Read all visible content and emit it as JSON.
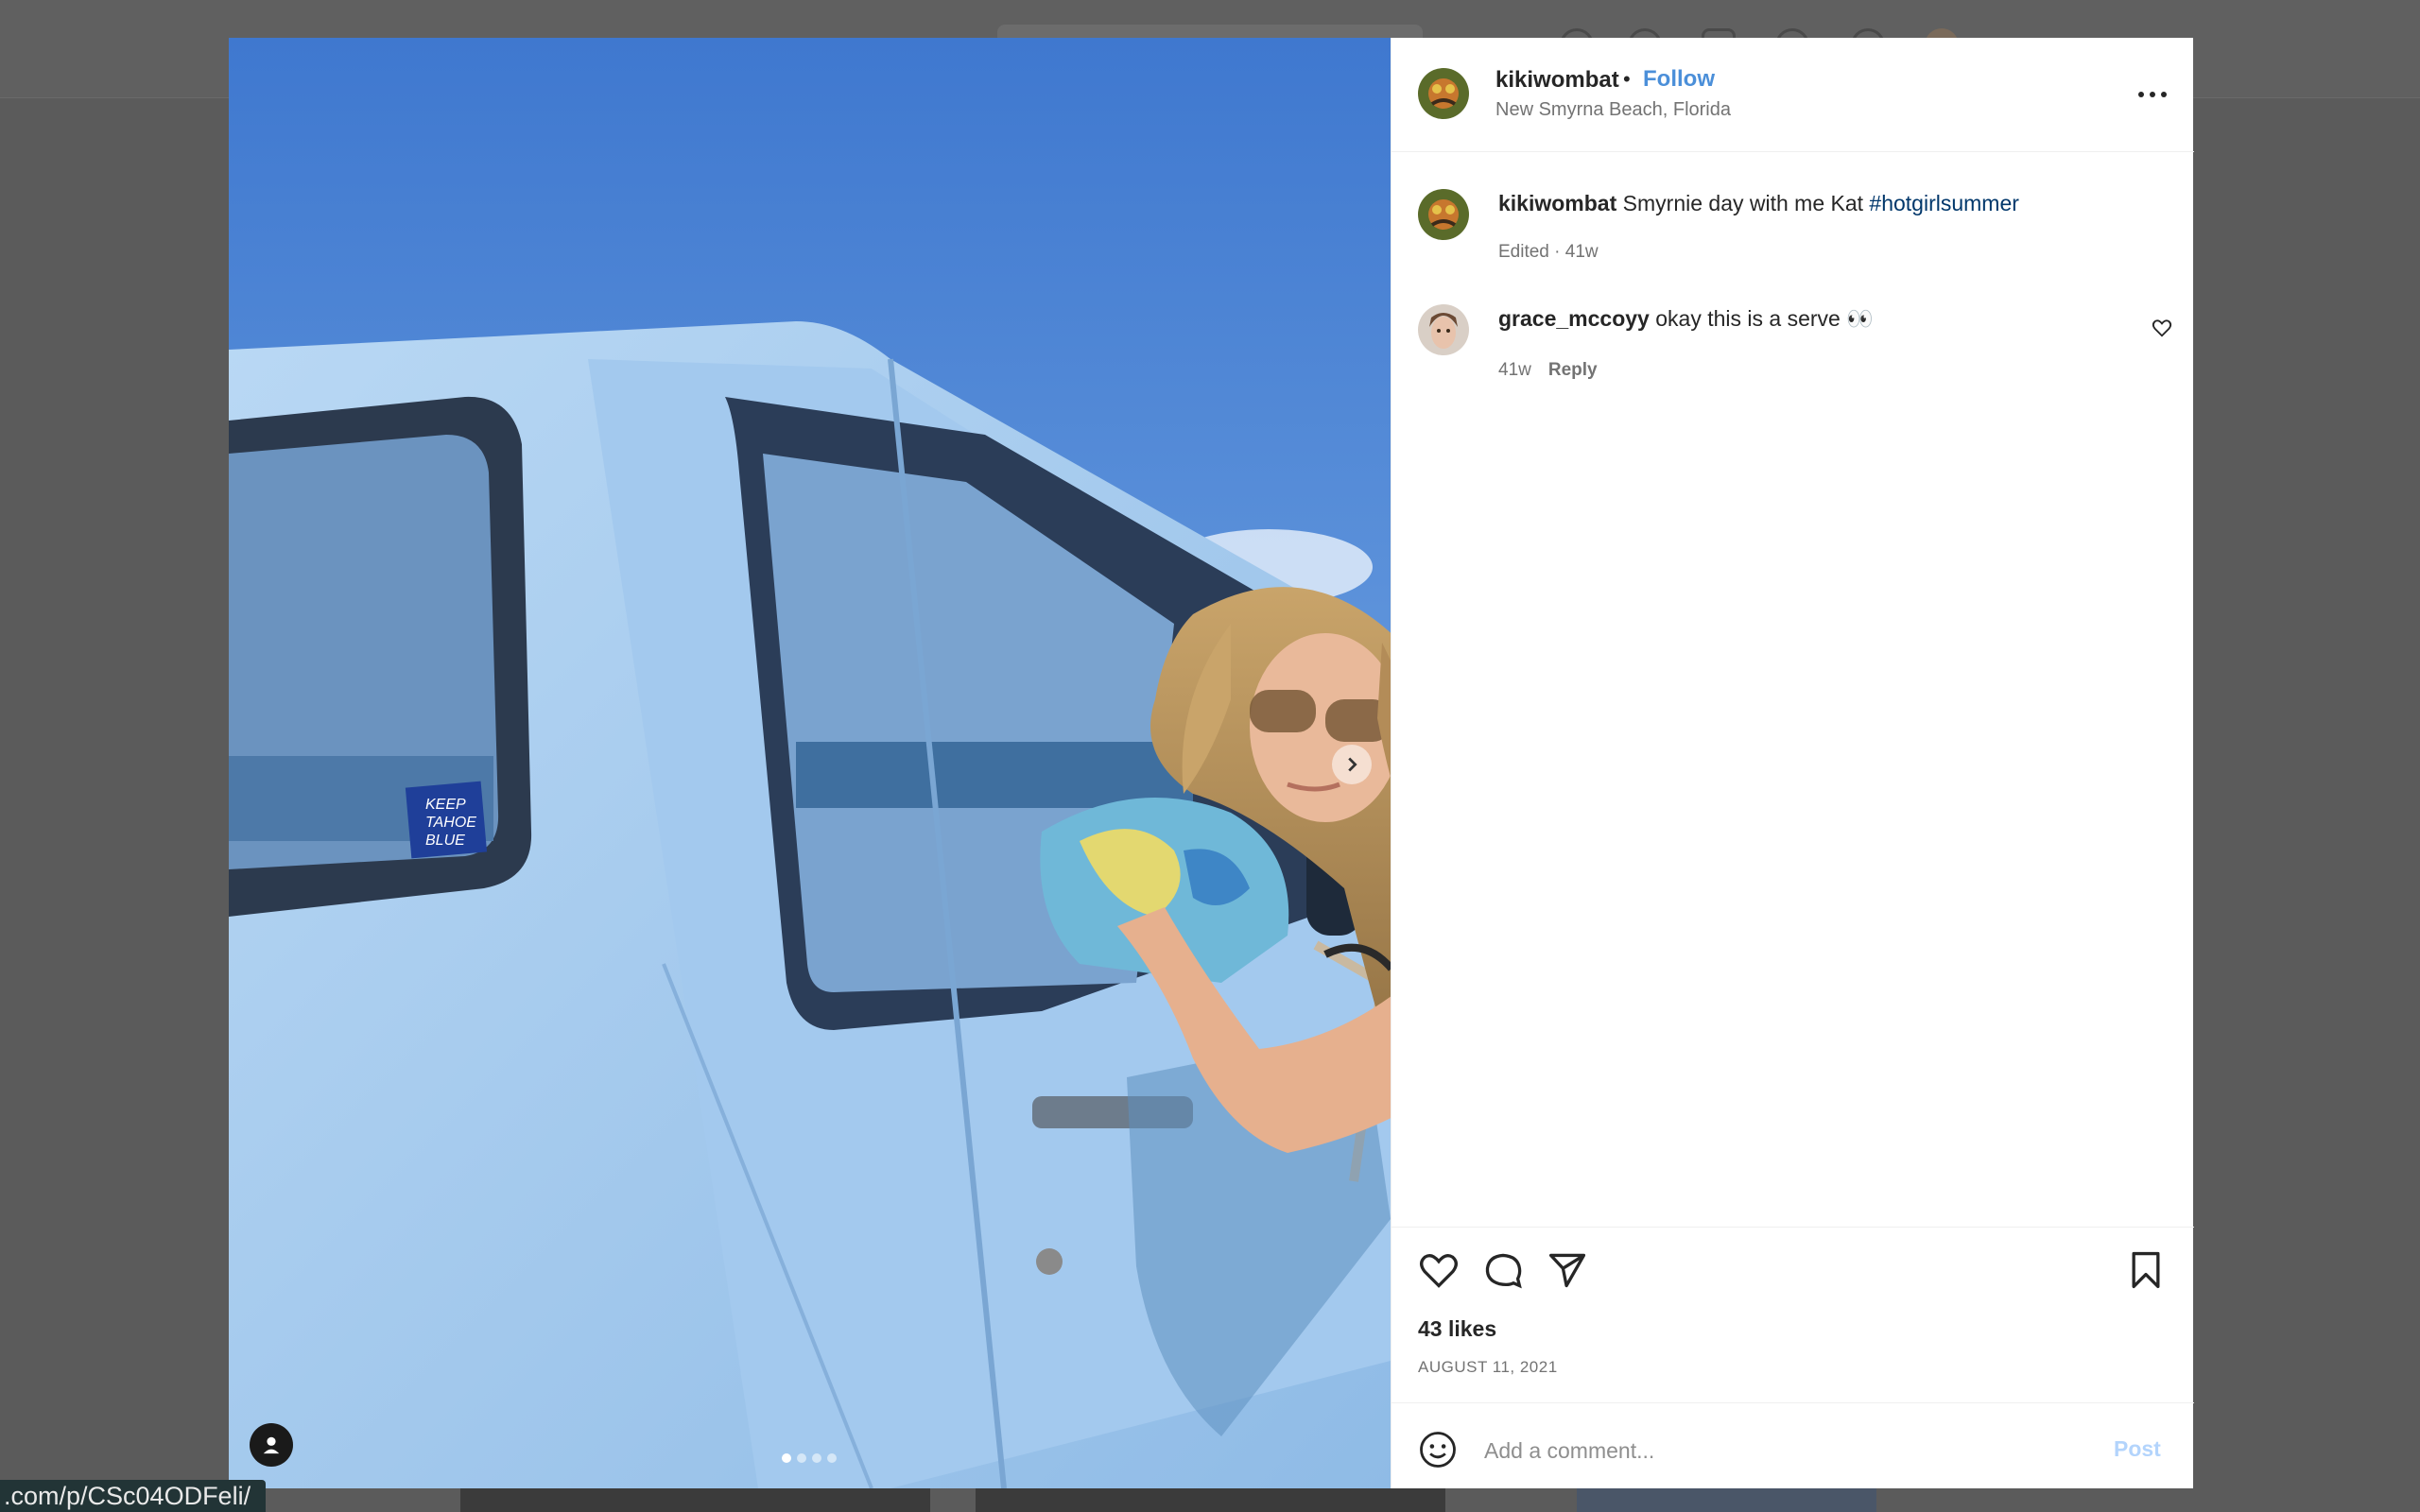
{
  "background": {
    "status_url": ".com/p/CSc04ODFeli/"
  },
  "post": {
    "username": "kikiwombat",
    "separator": "•",
    "follow_label": "Follow",
    "location": "New Smyrna Beach, Florida",
    "more_icon": "more-horizontal-icon",
    "media": {
      "slide_count": 4,
      "active_slide": 1,
      "next_icon": "chevron-right-icon",
      "tag_icon": "user-tag-icon",
      "sticker_text": [
        "KEEP",
        "TAHOE",
        "BLUE"
      ]
    }
  },
  "caption": {
    "username": "kikiwombat",
    "text": " Smyrnie day with me Kat ",
    "hashtag": "#hotgirlsummer",
    "meta": "Edited · 41w"
  },
  "comment": {
    "username": "grace_mccoyy",
    "text": " okay this is a serve 👀",
    "time": "41w",
    "reply_label": "Reply",
    "like_icon": "heart-icon"
  },
  "actions": {
    "like_icon": "heart-icon",
    "comment_icon": "comment-icon",
    "share_icon": "send-icon",
    "save_icon": "bookmark-icon",
    "likes": "43 likes",
    "date": "AUGUST 11, 2021"
  },
  "comment_box": {
    "emoji_icon": "smiley-icon",
    "placeholder": "Add a comment...",
    "post_label": "Post"
  },
  "colors": {
    "accent": "#4b8fd9",
    "post_disabled": "#b3d4fc",
    "truck": "#a9cdef",
    "sky": "#4f86d6"
  }
}
